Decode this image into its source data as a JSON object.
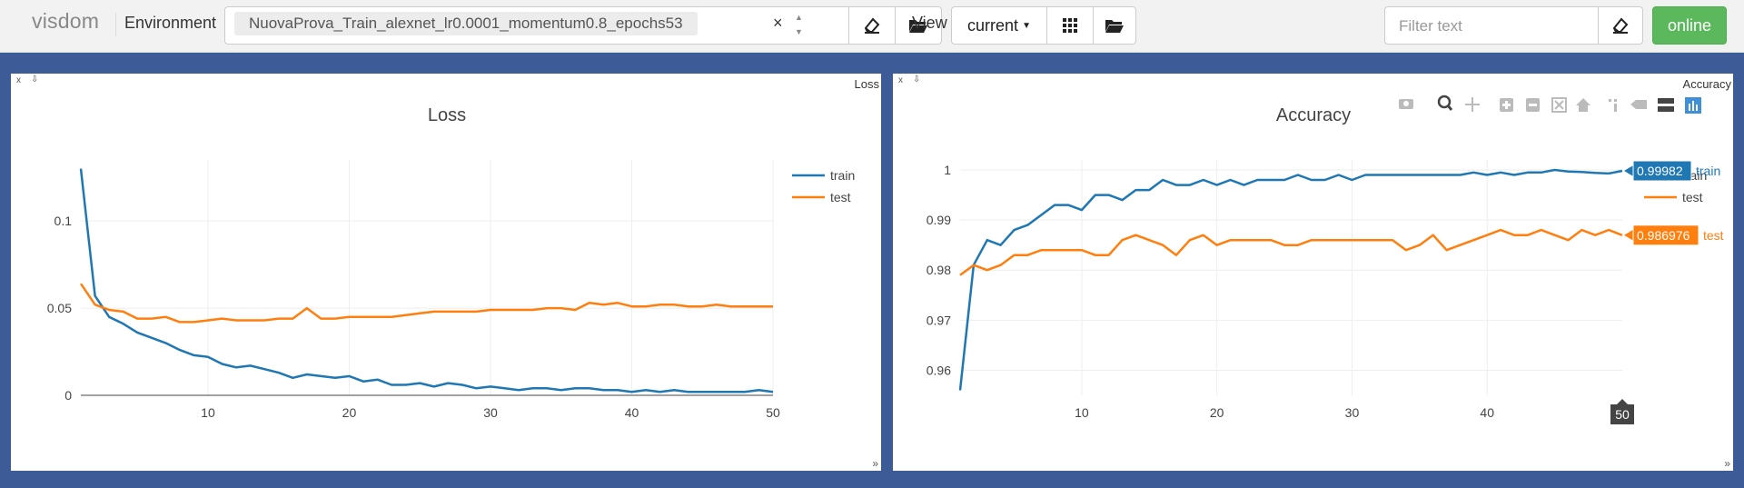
{
  "app": {
    "brand": "visdom",
    "environment_label": "Environment",
    "environment_value": "NuovaProva_Train_alexnet_lr0.0001_momentum0.8_epochs53",
    "view_label": "View",
    "view_value": "current",
    "filter_placeholder": "Filter text",
    "status": "online"
  },
  "panes": [
    {
      "title": "Loss",
      "header_label": "Loss"
    },
    {
      "title": "Accuracy",
      "header_label": "Accuracy",
      "hover_train": "0.99982",
      "hover_test": "0.986976",
      "hover_x": "50"
    }
  ],
  "colors": {
    "train": "#1f77b4",
    "test": "#ff7f0e",
    "stage": "#3d5b96",
    "online": "#5cb85c"
  },
  "chart_data": [
    {
      "type": "line",
      "title": "Loss",
      "xlim": [
        1,
        50
      ],
      "ylim": [
        0,
        0.135
      ],
      "x_ticks": [
        10,
        20,
        30,
        40,
        50
      ],
      "y_ticks": [
        0,
        0.05,
        0.1
      ],
      "y_tick_labels": [
        "0",
        "0.05",
        "0.1"
      ],
      "legend": "top-right",
      "series": [
        {
          "name": "train",
          "values": [
            0.13,
            0.057,
            0.045,
            0.041,
            0.036,
            0.033,
            0.03,
            0.026,
            0.023,
            0.022,
            0.018,
            0.016,
            0.017,
            0.015,
            0.013,
            0.01,
            0.012,
            0.011,
            0.01,
            0.011,
            0.008,
            0.009,
            0.006,
            0.006,
            0.007,
            0.005,
            0.007,
            0.006,
            0.004,
            0.005,
            0.004,
            0.003,
            0.004,
            0.004,
            0.003,
            0.004,
            0.004,
            0.003,
            0.003,
            0.002,
            0.003,
            0.002,
            0.003,
            0.002,
            0.002,
            0.002,
            0.002,
            0.002,
            0.003,
            0.002
          ]
        },
        {
          "name": "test",
          "values": [
            0.064,
            0.052,
            0.049,
            0.048,
            0.044,
            0.044,
            0.045,
            0.042,
            0.042,
            0.043,
            0.044,
            0.043,
            0.043,
            0.043,
            0.044,
            0.044,
            0.05,
            0.044,
            0.044,
            0.045,
            0.045,
            0.045,
            0.045,
            0.046,
            0.047,
            0.048,
            0.048,
            0.048,
            0.048,
            0.049,
            0.049,
            0.049,
            0.049,
            0.05,
            0.05,
            0.049,
            0.053,
            0.052,
            0.053,
            0.051,
            0.051,
            0.052,
            0.052,
            0.051,
            0.051,
            0.052,
            0.051,
            0.051,
            0.051,
            0.051
          ]
        }
      ]
    },
    {
      "type": "line",
      "title": "Accuracy",
      "xlim": [
        1,
        50
      ],
      "ylim": [
        0.955,
        1.002
      ],
      "x_ticks": [
        10,
        20,
        30,
        40
      ],
      "y_ticks": [
        0.96,
        0.97,
        0.98,
        0.99,
        1
      ],
      "y_tick_labels": [
        "0.96",
        "0.97",
        "0.98",
        "0.99",
        "1"
      ],
      "legend": "top-right",
      "series": [
        {
          "name": "train",
          "values": [
            0.956,
            0.981,
            0.986,
            0.985,
            0.988,
            0.989,
            0.991,
            0.993,
            0.993,
            0.992,
            0.995,
            0.995,
            0.994,
            0.996,
            0.996,
            0.998,
            0.997,
            0.997,
            0.998,
            0.997,
            0.998,
            0.997,
            0.998,
            0.998,
            0.998,
            0.999,
            0.998,
            0.998,
            0.999,
            0.998,
            0.999,
            0.999,
            0.999,
            0.999,
            0.999,
            0.999,
            0.999,
            0.999,
            0.9995,
            0.999,
            0.9995,
            0.999,
            0.9995,
            0.9995,
            1.0,
            0.9997,
            0.9996,
            0.9994,
            0.9993,
            0.99982
          ]
        },
        {
          "name": "test",
          "values": [
            0.979,
            0.981,
            0.98,
            0.981,
            0.983,
            0.983,
            0.984,
            0.984,
            0.984,
            0.984,
            0.983,
            0.983,
            0.986,
            0.987,
            0.986,
            0.985,
            0.983,
            0.986,
            0.987,
            0.985,
            0.986,
            0.986,
            0.986,
            0.986,
            0.985,
            0.985,
            0.986,
            0.986,
            0.986,
            0.986,
            0.986,
            0.986,
            0.986,
            0.984,
            0.985,
            0.987,
            0.984,
            0.985,
            0.986,
            0.987,
            0.988,
            0.987,
            0.987,
            0.988,
            0.987,
            0.986,
            0.988,
            0.987,
            0.988,
            0.986976
          ]
        }
      ]
    }
  ]
}
